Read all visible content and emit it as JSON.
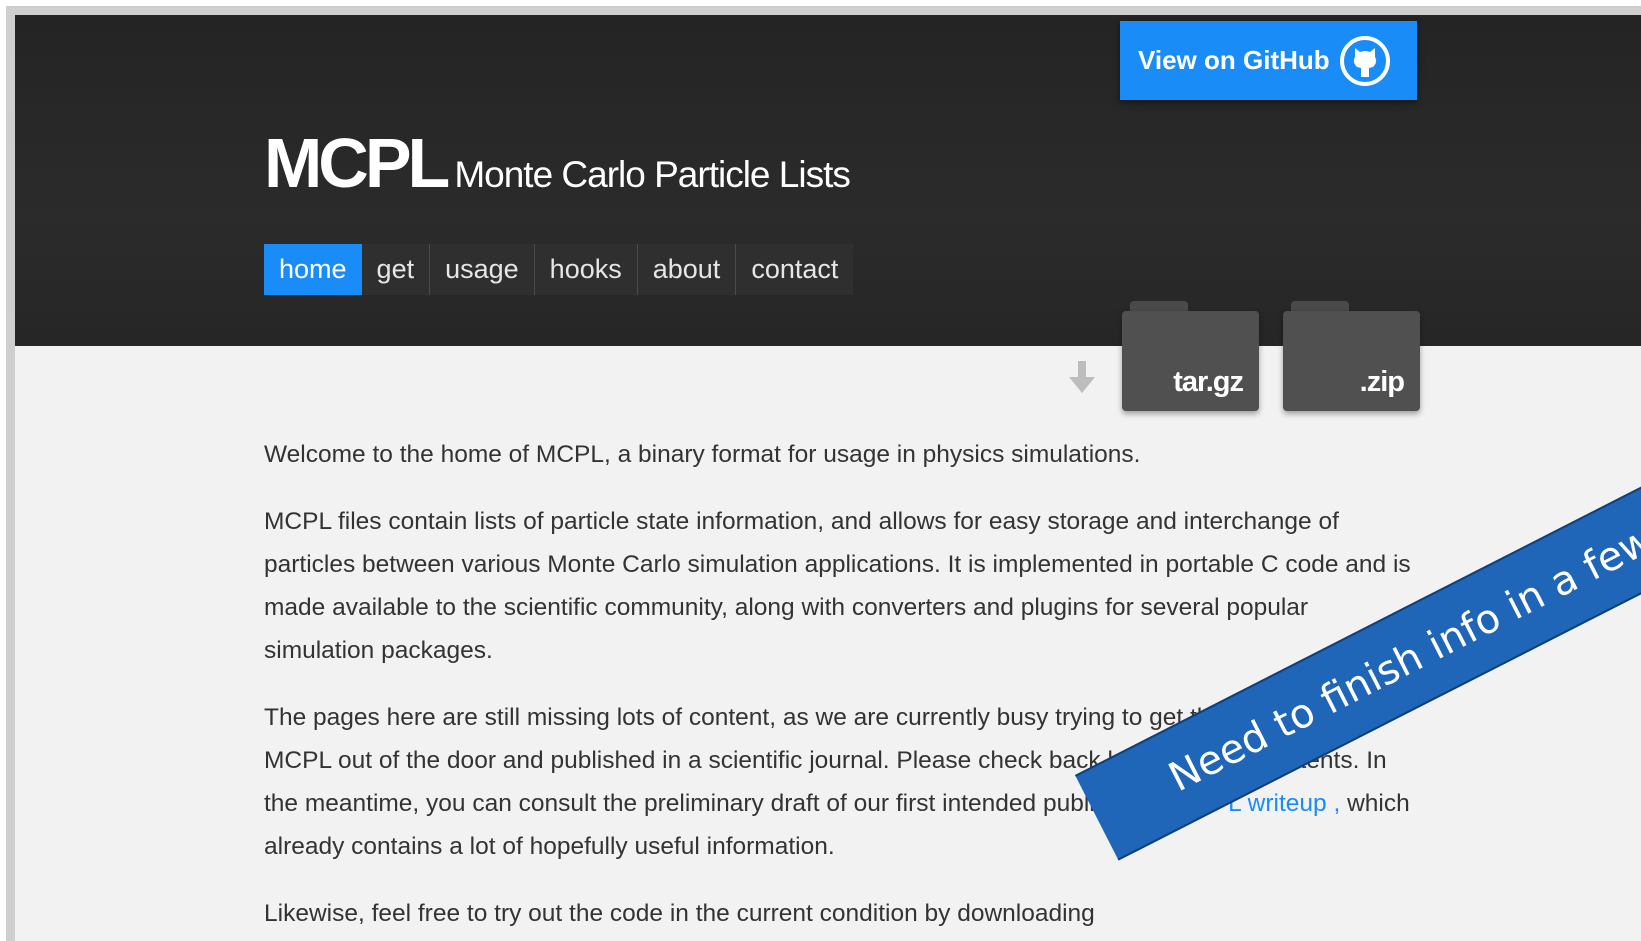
{
  "header": {
    "github_button": "View on GitHub",
    "title_main": "MCPL",
    "title_sub": "Monte Carlo Particle Lists",
    "nav": [
      "home",
      "get",
      "usage",
      "hooks",
      "about",
      "contact"
    ],
    "downloads": [
      "tar.gz",
      ".zip"
    ]
  },
  "content": {
    "p1": "Welcome to the home of MCPL, a binary format for usage in physics simulations.",
    "p2": "MCPL files contain lists of particle state information, and allows for easy storage and interchange of particles between various Monte Carlo simulation applications. It is implemented in portable C code and is made available to the scientific community, along with converters and plugins for several popular simulation packages.",
    "p3_before": "The pages here are still missing lots of content, as we are currently busy trying to get the first release of MCPL out of the door and published in a scientific journal. Please check back later for more contents. In the meantime, you can consult the preliminary draft of our first intended publication: ",
    "p3_link": "MCPL writeup ,",
    "p3_after": " which already contains a lot of hopefully useful information.",
    "p4": "Likewise, feel free to try out the code in the current condition by downloading"
  },
  "banner": {
    "text": "Need to finish info in a few sections"
  },
  "colors": {
    "accent": "#1a8cf7",
    "header_bg": "#262626",
    "banner": "#1f66b9"
  }
}
